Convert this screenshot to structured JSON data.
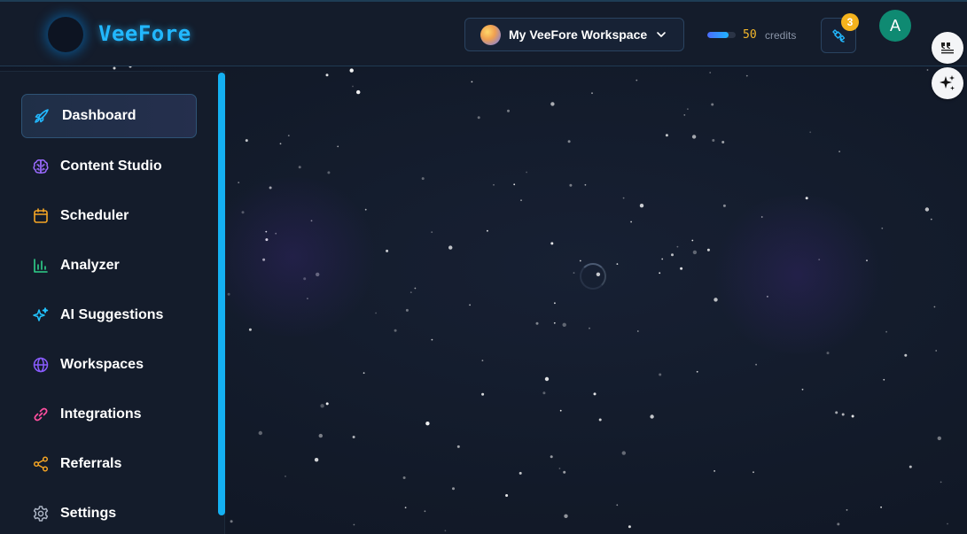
{
  "header": {
    "brand": "VeeFore",
    "workspace": {
      "name": "My VeeFore Workspace"
    },
    "credits": {
      "value": "50",
      "label": "credits",
      "fill_fraction": 0.75
    },
    "notifications": {
      "badge": "3"
    },
    "user": {
      "initial": "A"
    }
  },
  "sidebar": {
    "items": [
      {
        "label": "Dashboard",
        "icon": "rocket-icon",
        "color": "#22b8ff",
        "active": true
      },
      {
        "label": "Content Studio",
        "icon": "brain-icon",
        "color": "#9b6bff"
      },
      {
        "label": "Scheduler",
        "icon": "calendar-icon",
        "color": "#f5a524"
      },
      {
        "label": "Analyzer",
        "icon": "bar-chart-icon",
        "color": "#2fd18a"
      },
      {
        "label": "AI Suggestions",
        "icon": "sparkles-icon",
        "color": "#22c3ff"
      },
      {
        "label": "Workspaces",
        "icon": "globe-icon",
        "color": "#8a5cff"
      },
      {
        "label": "Integrations",
        "icon": "link-icon",
        "color": "#ff4fa0"
      },
      {
        "label": "Referrals",
        "icon": "share-icon",
        "color": "#f5a524"
      },
      {
        "label": "Settings",
        "icon": "gear-icon",
        "color": "#a9b2c2"
      }
    ]
  },
  "colors": {
    "accent": "#22b8ff",
    "badge": "#f5b31d",
    "avatar": "#0f8a72",
    "scrollbar": "#14b0f2"
  }
}
